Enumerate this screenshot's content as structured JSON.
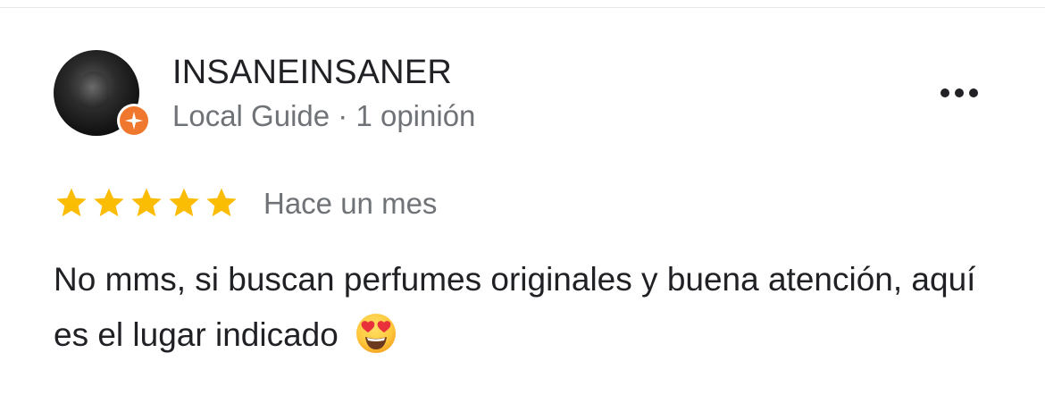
{
  "review": {
    "author_name": "INSANEINSANER",
    "author_meta": "Local Guide · 1 opinión",
    "rating": 5,
    "rating_max": 5,
    "time_ago": "Hace un mes",
    "text": "No mms, si buscan perfumes originales y buena atención, aquí es el lugar indicado",
    "emoji": "heart-eyes-emoji"
  },
  "icons": {
    "badge": "local-guide-star-icon",
    "more": "more-options-icon",
    "star": "star-icon"
  },
  "colors": {
    "star": "#FBBC04",
    "badge": "#F0782E",
    "text": "#202124",
    "secondary_text": "#6F7276"
  }
}
